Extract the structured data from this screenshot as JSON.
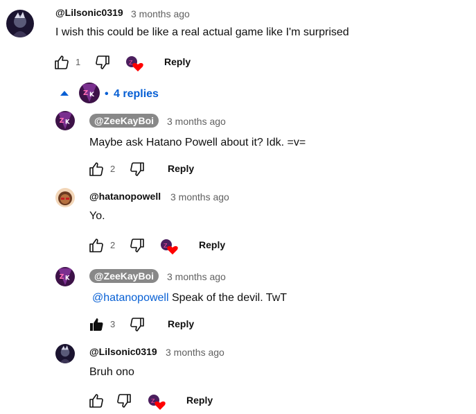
{
  "top_comment": {
    "author": "@Lilsonic0319",
    "time": "3 months ago",
    "text": "I wish this could be like a real actual game like I'm surprised",
    "likes": "1",
    "reply_label": "Reply"
  },
  "replies_toggle": {
    "dot": "•",
    "label": "4 replies"
  },
  "replies": [
    {
      "author": "@ZeeKayBoi",
      "time": "3 months ago",
      "text": "Maybe ask Hatano Powell about it? Idk. =v=",
      "likes": "2",
      "reply_label": "Reply"
    },
    {
      "author": "@hatanopowell",
      "time": "3 months ago",
      "text": "Yo.",
      "likes": "2",
      "reply_label": "Reply"
    },
    {
      "author": "@ZeeKayBoi",
      "time": "3 months ago",
      "mention": "@hatanopowell",
      "text": "Speak of the devil. TwT",
      "likes": "3",
      "reply_label": "Reply"
    },
    {
      "author": "@Lilsonic0319",
      "time": "3 months ago",
      "text": "Bruh ono",
      "reply_label": "Reply"
    }
  ],
  "colors": {
    "link": "#065fd4",
    "heart": "#ff0000",
    "pill": "#888888"
  }
}
